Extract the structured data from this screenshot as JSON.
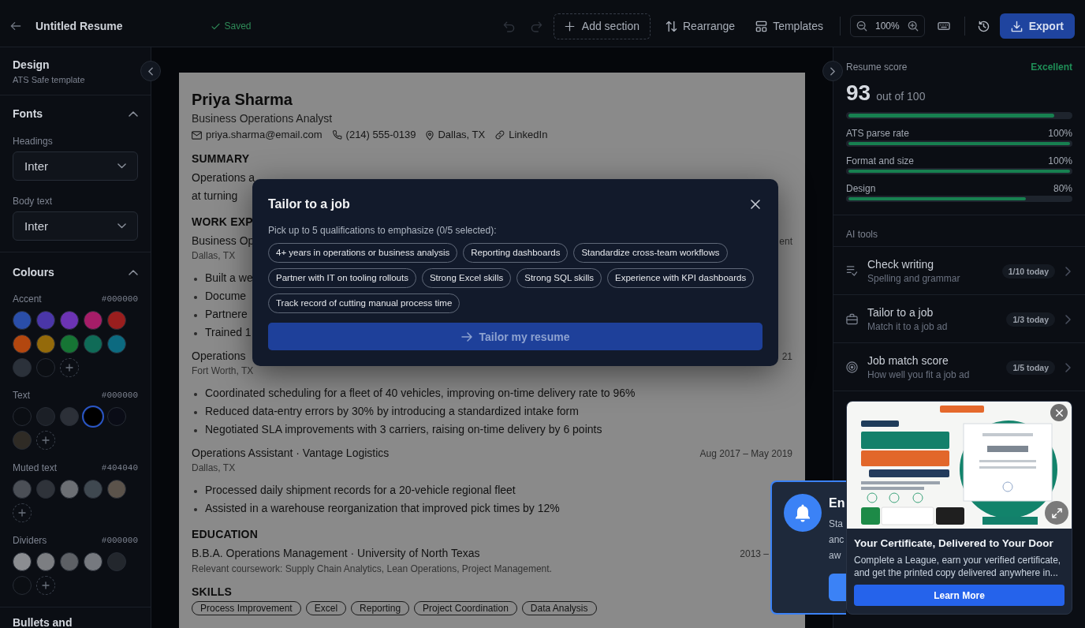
{
  "top_bar": {
    "title": "Untitled Resume",
    "save_status": "Saved",
    "undo": {
      "disabled": true
    },
    "redo": {
      "disabled": true
    },
    "add_section": "Add section",
    "rearrange": "Rearrange",
    "templates": "Templates",
    "zoom": "100%",
    "export": "Export"
  },
  "sidebar": {
    "title": "Design",
    "subtitle": "ATS Safe template",
    "fonts": {
      "title": "Fonts",
      "expanded": true,
      "fields": [
        {
          "label": "Headings",
          "value": "Inter"
        },
        {
          "label": "Body text",
          "value": "Inter"
        }
      ]
    },
    "colours": {
      "title": "Colours",
      "expanded": true,
      "groups": [
        {
          "label": "Accent",
          "value": "#000000",
          "swatches": [
            {
              "color": "#2a4ea9",
              "selected": false
            },
            {
              "color": "#4a36a8",
              "selected": false
            },
            {
              "color": "#6c33b3",
              "selected": false
            },
            {
              "color": "#a61d68",
              "selected": false
            },
            {
              "color": "#9a1e1e",
              "selected": false
            },
            {
              "color": "#b3470f",
              "selected": false
            },
            {
              "color": "#946a0a",
              "selected": false
            },
            {
              "color": "#167534",
              "selected": false
            },
            {
              "color": "#0f6b57",
              "selected": false
            },
            {
              "color": "#0c6a80",
              "selected": false
            },
            {
              "color": "#2b313a",
              "selected": false
            },
            {
              "color": "#0b0e13",
              "selected": false
            }
          ]
        },
        {
          "label": "Text",
          "value": "#000000",
          "swatches": [
            {
              "color": "#0b0e13",
              "selected": false
            },
            {
              "color": "#1b1f26",
              "selected": false
            },
            {
              "color": "#2c3038",
              "selected": false
            },
            {
              "color": "#000000",
              "selected": true
            },
            {
              "color": "#0a0c16",
              "selected": false
            },
            {
              "color": "#2f2b25",
              "selected": false
            }
          ]
        },
        {
          "label": "Muted text",
          "value": "#404040",
          "swatches": [
            {
              "color": "#4b4f56",
              "selected": false
            },
            {
              "color": "#2f333a",
              "selected": false
            },
            {
              "color": "#6c6f74",
              "selected": false
            },
            {
              "color": "#3f4850",
              "selected": false
            },
            {
              "color": "#5b534b",
              "selected": false
            }
          ]
        },
        {
          "label": "Dividers",
          "value": "#000000",
          "swatches": [
            {
              "color": "#8b8d91",
              "selected": false
            },
            {
              "color": "#7c7e82",
              "selected": false
            },
            {
              "color": "#5d6065",
              "selected": false
            },
            {
              "color": "#76797f",
              "selected": false
            },
            {
              "color": "#23272d",
              "selected": false
            },
            {
              "color": "#0b0e13",
              "selected": false
            }
          ]
        }
      ]
    },
    "next_section": {
      "title": "Bullets and"
    }
  },
  "resume": {
    "name": "Priya Sharma",
    "headline": "Business Operations Analyst",
    "contacts": [
      {
        "kind": "email",
        "text": "priya.sharma@email.com"
      },
      {
        "kind": "phone",
        "text": "(214) 555-0139"
      },
      {
        "kind": "location",
        "text": "Dallas, TX"
      },
      {
        "kind": "link",
        "text": "LinkedIn"
      }
    ],
    "sections": [
      {
        "kind": "summary",
        "heading": "SUMMARY",
        "lines": [
          "Operations a",
          "at turning"
        ]
      },
      {
        "kind": "experience",
        "heading": "WORK EXP",
        "entries": [
          {
            "title": "Business Op",
            "date": "ent",
            "location": "Dallas, TX",
            "bullets": [
              "Built a we",
              "Docume",
              "Partnere",
              "Trained 1"
            ]
          },
          {
            "title": "Operations",
            "date": "21",
            "location": "Fort Worth, TX",
            "bullets": [
              "Coordinated scheduling for a fleet of 40 vehicles, improving on-time delivery rate to 96%",
              "Reduced data-entry errors by 30% by introducing a standardized intake form",
              "Negotiated SLA improvements with 3 carriers, raising on-time delivery by 6 points"
            ]
          },
          {
            "title": "Operations Assistant · Vantage Logistics",
            "date": "Aug 2017 – May 2019",
            "location": "Dallas, TX",
            "bullets": [
              "Processed daily shipment records for a 20-vehicle regional fleet",
              "Assisted in a warehouse reorganization that improved pick times by 12%"
            ]
          }
        ]
      },
      {
        "kind": "education",
        "heading": "EDUCATION",
        "entries": [
          {
            "title": "B.B.A. Operations Management · University of North Texas",
            "date": "2013 –",
            "note": "Relevant coursework: Supply Chain Analytics, Lean Operations, Project Management."
          }
        ]
      },
      {
        "kind": "skills",
        "heading": "SKILLS",
        "chips": [
          "Process Improvement",
          "Excel",
          "Reporting",
          "Project Coordination",
          "Data Analysis"
        ]
      }
    ]
  },
  "modal": {
    "title": "Tailor to a job",
    "prompt": "Pick up to 5 qualifications to emphasize (0/5 selected):",
    "options": [
      {
        "label": "4+ years in operations or business analysis",
        "selected": false
      },
      {
        "label": "Reporting dashboards",
        "selected": false
      },
      {
        "label": "Standardize cross-team workflows",
        "selected": false
      },
      {
        "label": "Partner with IT on tooling rollouts",
        "selected": false
      },
      {
        "label": "Strong Excel skills",
        "selected": false
      },
      {
        "label": "Strong SQL skills",
        "selected": false
      },
      {
        "label": "Experience with KPI dashboards",
        "selected": false
      },
      {
        "label": "Track record of cutting manual process time",
        "selected": false
      }
    ],
    "submit": {
      "label": "Tailor my resume",
      "disabled": true
    }
  },
  "score": {
    "title": "Resume score",
    "rating": "Excellent",
    "value": "93",
    "out_of": "out of 100",
    "level": 0.93,
    "metrics": [
      {
        "label": "ATS parse rate",
        "value": "100%",
        "level": 1
      },
      {
        "label": "Format and size",
        "value": "100%",
        "level": 1
      },
      {
        "label": "Design",
        "value": "80%",
        "level": 0.8
      }
    ]
  },
  "ai_tools": {
    "title": "AI tools",
    "items": [
      {
        "title": "Check writing",
        "subtitle": "Spelling and grammar",
        "usage": "1/10 today"
      },
      {
        "title": "Tailor to a job",
        "subtitle": "Match it to a job ad",
        "usage": "1/3 today"
      },
      {
        "title": "Job match score",
        "subtitle": "How well you fit a job ad",
        "usage": "1/5 today"
      }
    ]
  },
  "notification": {
    "title": "En",
    "lines": [
      "Sta",
      "anc",
      "aw"
    ]
  },
  "promo": {
    "title": "Your Certificate, Delivered to Your Door",
    "text": "Complete a League, earn your verified certificate, and get the printed copy delivered anywhere in...",
    "button": "Learn More"
  }
}
